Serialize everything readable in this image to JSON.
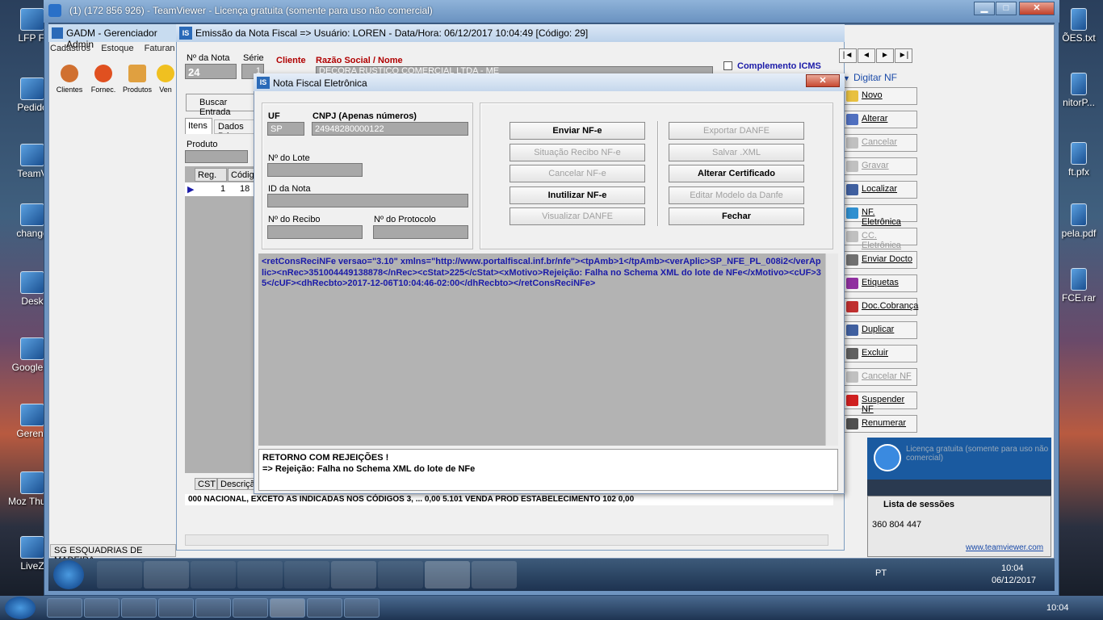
{
  "desktop_left": [
    {
      "label": "LFP Fi"
    },
    {
      "label": "Pedido"
    },
    {
      "label": "TeamV"
    },
    {
      "label": "change"
    },
    {
      "label": "Desk"
    },
    {
      "label": "Google C"
    },
    {
      "label": "Gerenc"
    },
    {
      "label": "Moz Thund"
    },
    {
      "label": "LiveZ"
    }
  ],
  "desktop_right": [
    {
      "label": "ÕES.txt"
    },
    {
      "label": "nitorP..."
    },
    {
      "label": "ft.pfx"
    },
    {
      "label": "pela.pdf"
    },
    {
      "label": "FCE.rar"
    }
  ],
  "teamviewer": {
    "title": "(1) (172 856 926) - TeamViewer - Licença gratuita (somente para uso não comercial)",
    "min": "▁",
    "max": "□",
    "close": "✕"
  },
  "gadm": {
    "title": "GADM - Gerenciador Admin",
    "menu": [
      "Cadastros",
      "Estoque",
      "Faturan"
    ],
    "toolbar": [
      "Clientes",
      "Fornec.",
      "Produtos",
      "Ven"
    ],
    "status": "SG  ESQUADRIAS DE MADEIRA"
  },
  "emissao": {
    "title": "Emissão da Nota Fiscal  => Usuário: LOREN - Data/Hora: 06/12/2017 10:04:49  [Código: 29]",
    "nnota_label": "Nº da Nota",
    "nnota": "24",
    "serie_label": "Série",
    "serie": "1",
    "cliente_label": "Cliente",
    "razao_label": "Razão Social / Nome",
    "razao": "DECORA RUSTICO COMERCIAL LTDA - ME",
    "complemento": "Complemento ICMS",
    "digitar": "Digitar NF",
    "buscar": "Buscar Entrada",
    "tabs": [
      "Itens",
      "Dados Pri"
    ],
    "produto_label": "Produto",
    "grid_headers": [
      "Reg.",
      "Códig"
    ],
    "grid_row": [
      "1",
      "18"
    ],
    "bottom_headers": [
      "CST",
      "Descriçã"
    ],
    "bottom_row": "000  NACIONAL, EXCETO AS INDICADAS NOS CÓDIGOS 3, ...  0,00  5.101  VENDA PROD ESTABELECIMENTO  102  0,00",
    "nav": [
      "|◄",
      "◄",
      "►",
      "►|"
    ],
    "right_buttons": [
      {
        "label": "Novo",
        "enabled": true,
        "color": "#e8c040"
      },
      {
        "label": "Alterar",
        "enabled": true,
        "color": "#5070c0"
      },
      {
        "label": "Cancelar",
        "enabled": false,
        "color": "#c0c0c0"
      },
      {
        "label": "Gravar",
        "enabled": false,
        "color": "#c0c0c0"
      },
      {
        "label": "Localizar",
        "enabled": true,
        "color": "#4060a0"
      },
      {
        "label": "NF. Eletrônica",
        "enabled": true,
        "color": "#3090d0"
      },
      {
        "label": "CC. Eletrônica",
        "enabled": false,
        "color": "#c0c0c0"
      },
      {
        "label": "Enviar Docto",
        "enabled": true,
        "color": "#707070"
      },
      {
        "label": "Etiquetas",
        "enabled": true,
        "color": "#9030a0"
      },
      {
        "label": "Doc.Cobrança",
        "enabled": true,
        "color": "#c03030"
      },
      {
        "label": "Duplicar",
        "enabled": true,
        "color": "#4060a0"
      },
      {
        "label": "Excluir",
        "enabled": true,
        "color": "#606060"
      },
      {
        "label": "Cancelar NF",
        "enabled": false,
        "color": "#c0c0c0"
      },
      {
        "label": "Suspender NF",
        "enabled": true,
        "color": "#d02020"
      },
      {
        "label": "Renumerar",
        "enabled": true,
        "color": "#505050"
      }
    ]
  },
  "nfe_dialog": {
    "title": "Nota Fiscal Eletrônica",
    "close": "✕",
    "uf_label": "UF",
    "uf": "SP",
    "cnpj_label": "CNPJ (Apenas números)",
    "cnpj": "24948280000122",
    "lote_label": "Nº do Lote",
    "idnota_label": "ID da Nota",
    "recibo_label": "Nº do Recibo",
    "protocolo_label": "Nº do Protocolo",
    "buttons_left": [
      {
        "label": "Enviar NF-e",
        "enabled": true
      },
      {
        "label": "Situação Recibo NF-e",
        "enabled": false
      },
      {
        "label": "Cancelar NF-e",
        "enabled": false
      },
      {
        "label": "Inutilizar NF-e",
        "enabled": true
      },
      {
        "label": "Visualizar DANFE",
        "enabled": false
      }
    ],
    "buttons_right": [
      {
        "label": "Exportar DANFE",
        "enabled": false
      },
      {
        "label": "Salvar .XML",
        "enabled": false
      },
      {
        "label": "Alterar Certificado",
        "enabled": true
      },
      {
        "label": "Editar Modelo da Danfe",
        "enabled": false
      },
      {
        "label": "Fechar",
        "enabled": true
      }
    ],
    "xml": "<retConsReciNFe versao=\"3.10\" xmlns=\"http://www.portalfiscal.inf.br/nfe\"><tpAmb>1</tpAmb><verAplic>SP_NFE_PL_008i2</verAplic><nRec>351004449138878</nRec><cStat>225</cStat><xMotivo>Rejeição: Falha no Schema XML do lote de NFe</xMotivo><cUF>35</cUF><dhRecbto>2017-12-06T10:04:46-02:00</dhRecbto></retConsReciNFe>",
    "result_line1": "RETORNO COM REJEIÇÕES !",
    "result_line2": "=> Rejeição: Falha no Schema XML do lote de NFe"
  },
  "tv_popup": {
    "license": "Licença gratuita (somente para uso não comercial)",
    "sessions_label": "Lista de sessões",
    "session_id": "360 804 447",
    "link": "www.teamviewer.com"
  },
  "remote_tray": {
    "lang": "PT",
    "time": "10:04",
    "date": "06/12/2017"
  },
  "local_tray": {
    "time": "10:04"
  }
}
